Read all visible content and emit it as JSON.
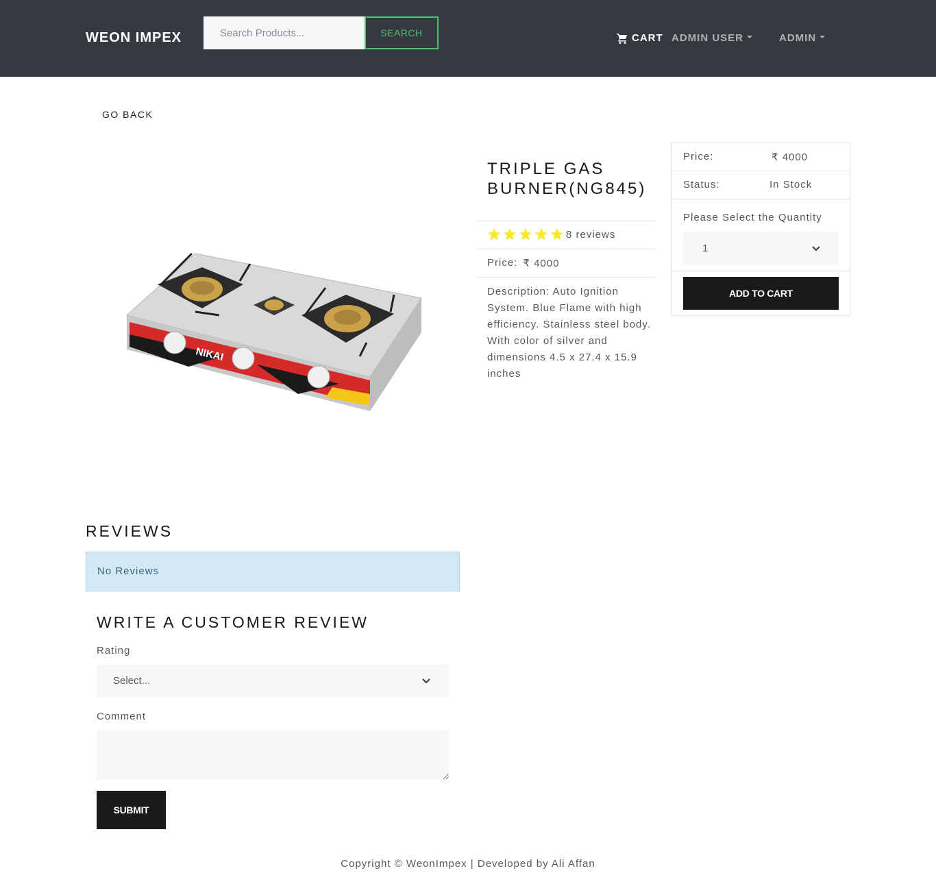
{
  "header": {
    "brand": "WEON IMPEX",
    "search_placeholder": "Search Products...",
    "search_label": "SEARCH",
    "cart_label": "CART",
    "user_menu_label": "ADMIN USER",
    "admin_menu_label": "ADMIN",
    "background_color": "#343a40",
    "search_accent_color": "#4bbf73"
  },
  "go_back_label": "GO BACK",
  "product": {
    "name": "TRIPLE GAS BURNER(NG845)",
    "rating": 5,
    "reviews_text": "8 reviews",
    "price_label": "Price:",
    "currency_symbol": "₹",
    "price": "4000",
    "description": "Description: Auto Ignition System. Blue Flame with high efficiency. Stainless steel body. With color of silver and dimensions 4.5 x 27.4 x 15.9 inches",
    "image_brand_text": "NIKAI",
    "star_color": "#f8e825"
  },
  "purchase_card": {
    "price_label": "Price:",
    "currency_symbol": "₹",
    "price_value": "4000",
    "status_label": "Status:",
    "status_value": "In Stock",
    "quantity_label": "Please Select the Quantity",
    "quantity_value": "1",
    "add_to_cart_label": "ADD TO CART"
  },
  "reviews": {
    "title": "REVIEWS",
    "empty_message": "No Reviews",
    "write_title": "WRITE A CUSTOMER REVIEW",
    "rating_label": "Rating",
    "rating_value": "Select...",
    "comment_label": "Comment",
    "comment_value": "",
    "submit_label": "SUBMIT"
  },
  "footer": {
    "text": "Copyright © WeonImpex | Developed by Ali Affan"
  }
}
